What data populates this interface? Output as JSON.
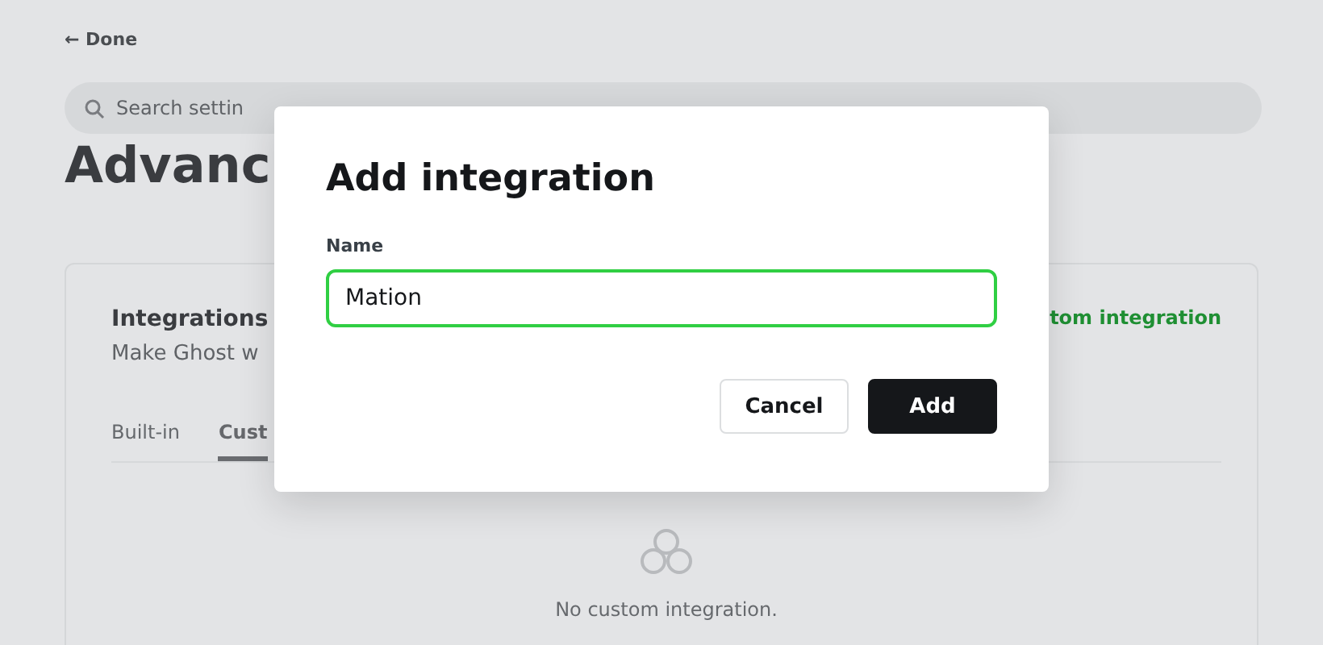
{
  "background": {
    "back_link": "← Done",
    "search": {
      "placeholder": "Search settin"
    },
    "title": "Advanc",
    "card": {
      "title": "Integrations",
      "description": "Make Ghost w",
      "action": "tom integration",
      "tabs": [
        {
          "label": "Built-in",
          "selected": false
        },
        {
          "label": "Cust",
          "selected": true
        }
      ],
      "empty_text": "No custom integration."
    }
  },
  "dialog": {
    "title": "Add integration",
    "field": {
      "label": "Name",
      "value": "Mation",
      "focused": true
    },
    "buttons": [
      {
        "label": "Cancel",
        "kind": "secondary"
      },
      {
        "label": "Add",
        "kind": "primary"
      }
    ]
  }
}
